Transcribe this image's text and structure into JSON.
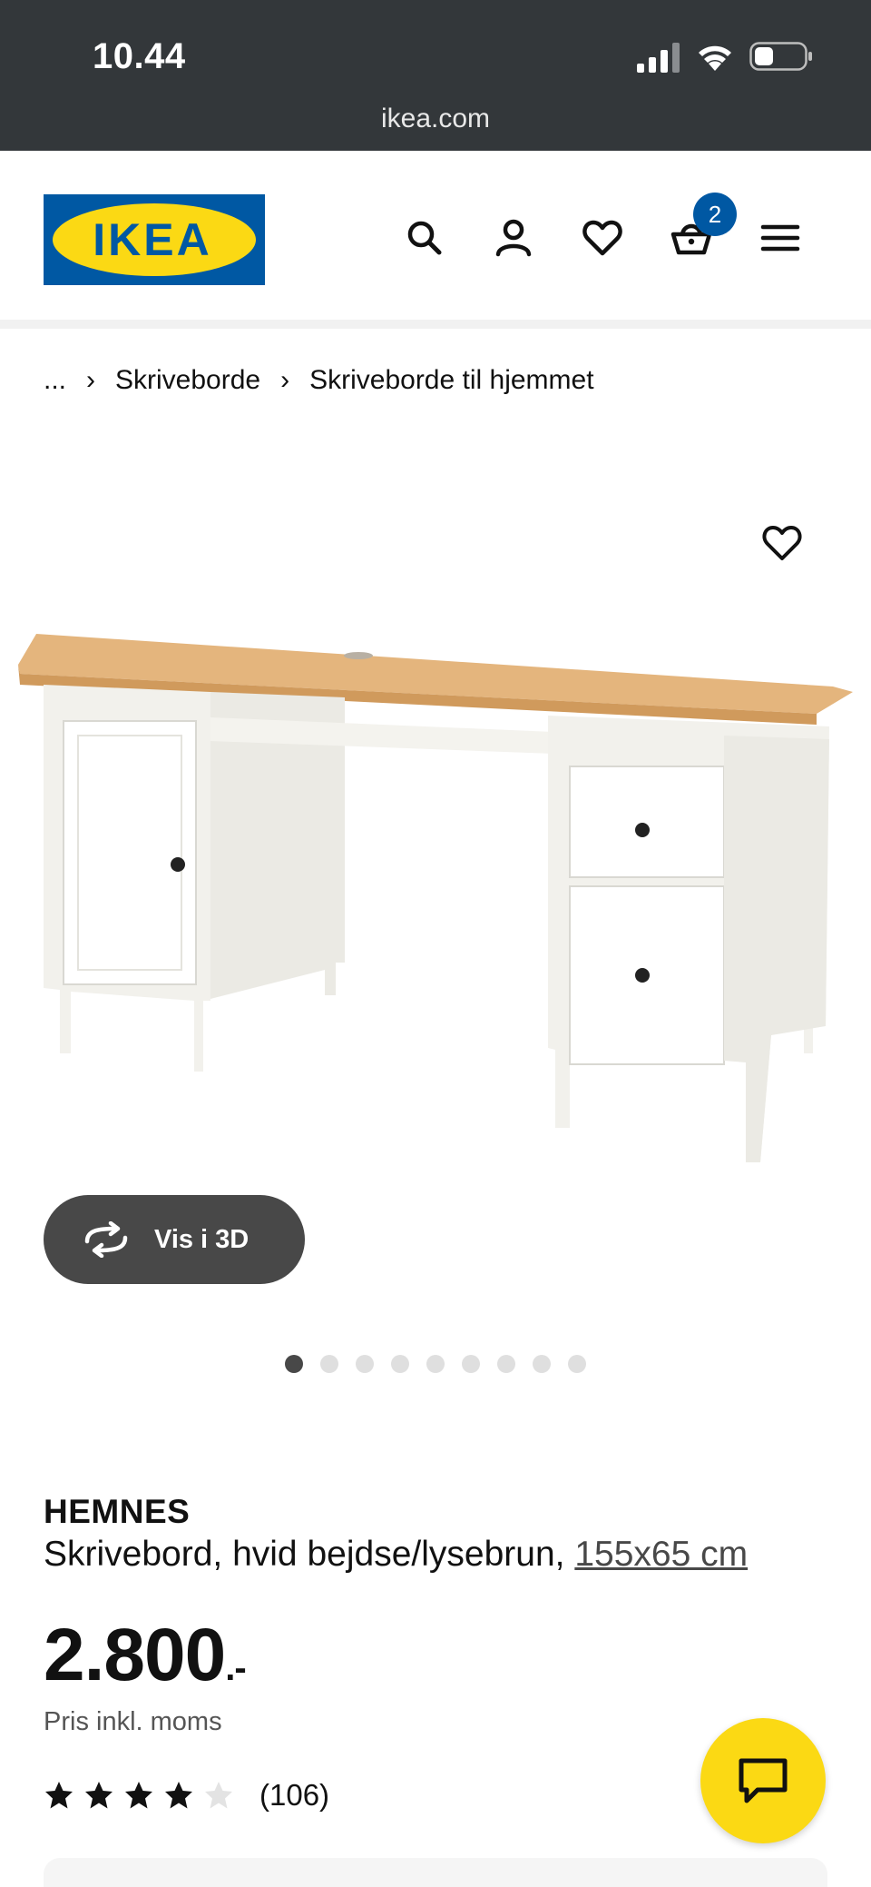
{
  "status_bar": {
    "time": "10.44",
    "url": "ikea.com"
  },
  "header": {
    "logo_text": "IKEA",
    "cart_count": "2",
    "brand_colors": {
      "blue": "#0058a3",
      "yellow": "#fbd914"
    },
    "icons": [
      "search-icon",
      "profile-icon",
      "heart-icon",
      "cart-icon",
      "menu-icon"
    ]
  },
  "breadcrumb": {
    "ellipsis": "...",
    "items": [
      "Skriveborde",
      "Skriveborde til hjemmet"
    ]
  },
  "gallery": {
    "view_3d_label": "Vis i 3D",
    "total_images": 9,
    "active_index": 0
  },
  "product": {
    "name": "HEMNES",
    "description": "Skrivebord, hvid bejdse/lysebrun,",
    "size_link": "155x65 cm",
    "price": "2.800",
    "price_suffix": ".-",
    "price_note": "Pris inkl. moms",
    "rating": 4,
    "rating_max": 5,
    "review_count": "(106)"
  }
}
